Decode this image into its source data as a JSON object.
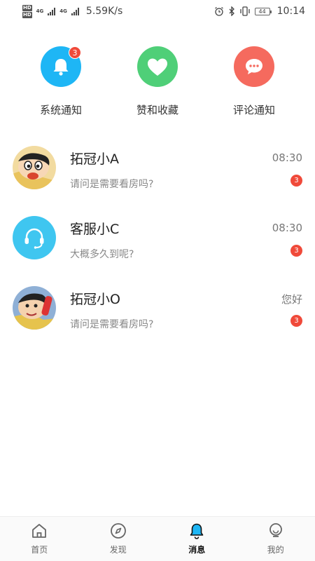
{
  "status_bar": {
    "hd1": "HD",
    "hd2": "HD",
    "net1": "4G",
    "net2": "4G",
    "speed": "5.59K/s",
    "battery": "44",
    "time": "10:14",
    "icons": [
      "alarm-icon",
      "bluetooth-icon",
      "vibrate-icon"
    ]
  },
  "quick_actions": [
    {
      "label": "系统通知",
      "icon": "bell-icon",
      "badge": "3",
      "color": "#1eb6f5"
    },
    {
      "label": "赞和收藏",
      "icon": "heart-icon",
      "badge": "",
      "color": "#4fcf78"
    },
    {
      "label": "评论通知",
      "icon": "chat-bubble-icon",
      "badge": "",
      "color": "#f56a5e"
    }
  ],
  "messages": [
    {
      "name": "拓冠小A",
      "time": "08:30",
      "preview": "请问是需要看房吗?",
      "badge": "3",
      "avatar": "cartoon-avatar"
    },
    {
      "name": "客服小C",
      "time": "08:30",
      "preview": "大概多久到呢?",
      "badge": "3",
      "avatar": "headset-icon"
    },
    {
      "name": "拓冠小O",
      "time": "您好",
      "preview": "请问是需要看房吗?",
      "badge": "3",
      "avatar": "cartoon-avatar"
    }
  ],
  "bottom_nav": [
    {
      "label": "首页",
      "icon": "home-icon"
    },
    {
      "label": "发现",
      "icon": "compass-icon"
    },
    {
      "label": "消息",
      "icon": "bell-icon",
      "active": true
    },
    {
      "label": "我的",
      "icon": "profile-icon"
    }
  ],
  "colors": {
    "accent_blue": "#1eb6f5",
    "accent_green": "#4fcf78",
    "accent_red": "#f56a5e",
    "badge_red": "#f04a3a",
    "headset_avatar": "#3fc6f0"
  }
}
